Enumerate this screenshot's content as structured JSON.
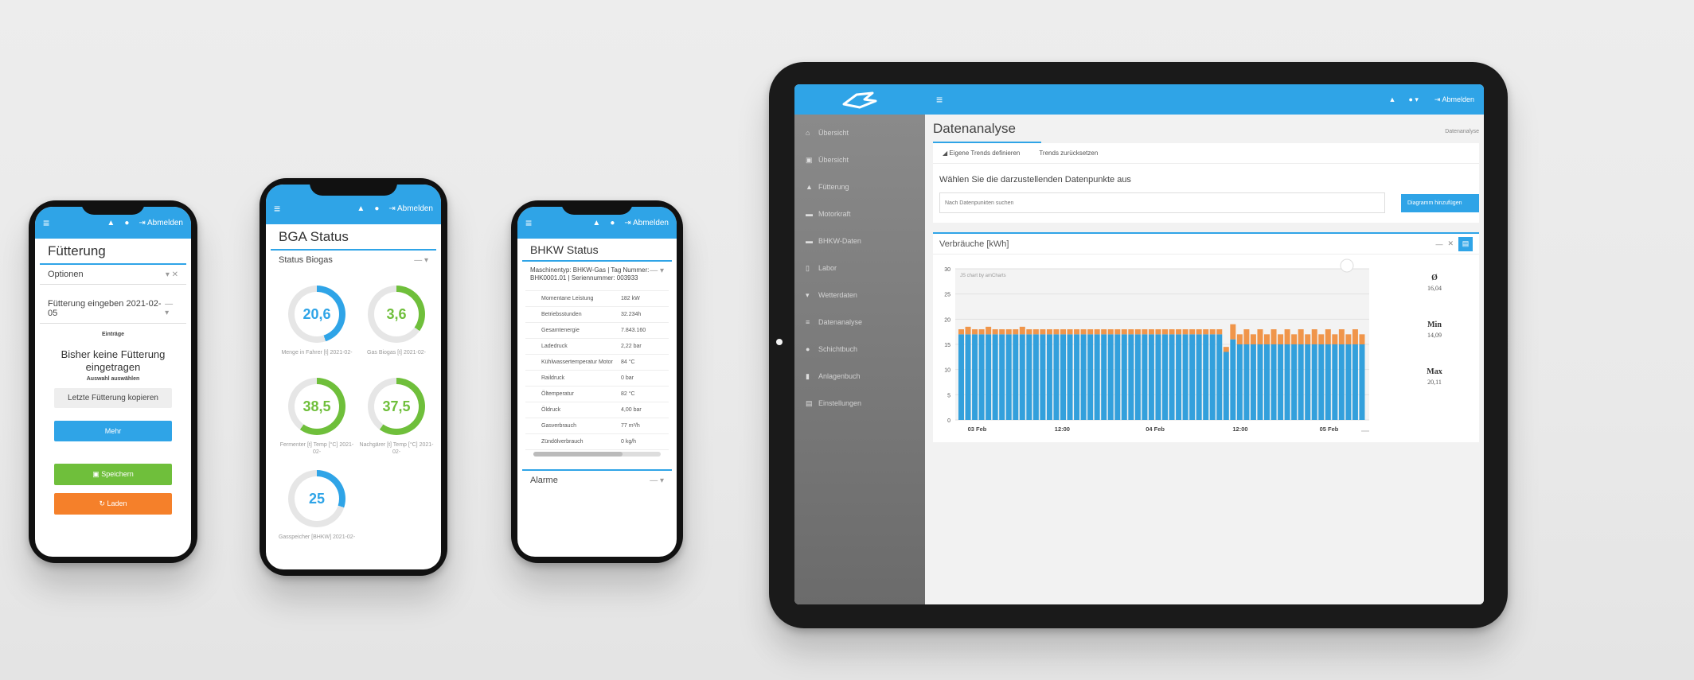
{
  "topbar": {
    "logout": "Abmelden"
  },
  "phone1": {
    "title": "Fütterung",
    "options_label": "Optionen",
    "entry_label": "Fütterung eingeben 2021-02-05",
    "entries_heading": "Einträge",
    "empty_message": "Bisher keine Fütterung eingetragen",
    "select_all": "Auswahl auswählen",
    "copy_last_button": "Letzte Fütterung kopieren",
    "more_button": "Mehr",
    "save_button": "Speichern",
    "reload_button": "Laden"
  },
  "phone2": {
    "title": "BGA Status",
    "panel_title": "Status Biogas",
    "gauges": [
      {
        "value": "20,6",
        "label": "Menge in Fahrer [t] 2021-02-",
        "color": "#2fa4e7",
        "fill": 0.45
      },
      {
        "value": "3,6",
        "label": "Gas Biogas [t] 2021-02-",
        "color": "#6fbf3b",
        "fill": 0.35
      },
      {
        "value": "38,5",
        "label": "Fermenter [t] Temp [°C] 2021-02-",
        "color": "#6fbf3b",
        "fill": 0.6
      },
      {
        "value": "37,5",
        "label": "Nachgärer [t] Temp [°C] 2021-02-",
        "color": "#6fbf3b",
        "fill": 0.6
      },
      {
        "value": "25",
        "label": "Gasspeicher [BHKW] 2021-02-",
        "color": "#2fa4e7",
        "fill": 0.3
      }
    ]
  },
  "phone3": {
    "title": "BHKW Status",
    "header": "Maschinentyp: BHKW-Gas | Tag Nummer: BHK0001.01 | Seriennummer: 003933",
    "rows": [
      {
        "key": "Momentane Leistung",
        "value": "182 kW"
      },
      {
        "key": "Betriebsstunden",
        "value": "32.234h"
      },
      {
        "key": "Gesamtenergie",
        "value": "7.843.160"
      },
      {
        "key": "Ladedruck",
        "value": "2,22 bar"
      },
      {
        "key": "Kühlwassertemperatur Motor",
        "value": "84 °C"
      },
      {
        "key": "Raildruck",
        "value": "0 bar"
      },
      {
        "key": "Öltemperatur",
        "value": "82 °C"
      },
      {
        "key": "Öldruck",
        "value": "4,00 bar"
      },
      {
        "key": "Gasverbrauch",
        "value": "77 m³/h"
      },
      {
        "key": "Zündölverbrauch",
        "value": "0 kg/h"
      }
    ],
    "alarms": "Alarme"
  },
  "tablet": {
    "page_title": "Datenanalyse",
    "breadcrumb": "Datenanalyse",
    "sidebar": [
      {
        "icon": "home-icon",
        "glyph": "⌂",
        "label": "Übersicht"
      },
      {
        "icon": "chart-icon",
        "glyph": "▣",
        "label": "Übersicht"
      },
      {
        "icon": "feed-icon",
        "glyph": "▲",
        "label": "Fütterung"
      },
      {
        "icon": "truck-icon",
        "glyph": "▬",
        "label": "Motorkraft"
      },
      {
        "icon": "engine-icon",
        "glyph": "▬",
        "label": "BHKW-Daten"
      },
      {
        "icon": "file-icon",
        "glyph": "▯",
        "label": "Labor"
      },
      {
        "icon": "arrow-icon",
        "glyph": "▾",
        "label": "Wetterdaten"
      },
      {
        "icon": "analysis-icon",
        "glyph": "≡",
        "label": "Datenanalyse"
      },
      {
        "icon": "pin-icon",
        "glyph": "●",
        "label": "Schichtbuch"
      },
      {
        "icon": "book-icon",
        "glyph": "▮",
        "label": "Anlagenbuch"
      },
      {
        "icon": "settings-icon",
        "glyph": "▤",
        "label": "Einstellungen"
      }
    ],
    "tabs": [
      "Eigene Trends definieren",
      "Trends zurücksetzen"
    ],
    "prompt": "Wählen Sie die darzustellenden Datenpunkte aus",
    "search_placeholder": "Nach Datenpunkten suchen",
    "add_button": "Diagramm hinzufügen",
    "chart_title": "Verbräuche [kWh]",
    "credit": "JS chart by amCharts",
    "stats": [
      {
        "label": "Ø",
        "value": "16,04"
      },
      {
        "label": "Min",
        "value": "14,09"
      },
      {
        "label": "Max",
        "value": "20,11"
      }
    ]
  },
  "chart_data": {
    "type": "bar",
    "title": "Verbräuche [kWh]",
    "x_ticks": [
      "03 Feb",
      "12:00",
      "04 Feb",
      "12:00",
      "05 Feb"
    ],
    "y_ticks": [
      0,
      5,
      10,
      15,
      20,
      25,
      30
    ],
    "ylim": [
      0,
      30
    ],
    "series": [
      {
        "color": "#33a0dc",
        "values": [
          17,
          17,
          17,
          17,
          17,
          17,
          17,
          17,
          17,
          17,
          17,
          17,
          17,
          17,
          17,
          17,
          17,
          17,
          17,
          17,
          17,
          17,
          17,
          17,
          17,
          17,
          17,
          17,
          17,
          17,
          17,
          17,
          17,
          17,
          17,
          17,
          17,
          17,
          17,
          13.5,
          16,
          15,
          15,
          15,
          15,
          15,
          15,
          15,
          15,
          15,
          15,
          15,
          15,
          15,
          15,
          15,
          15,
          15,
          15,
          15
        ]
      },
      {
        "color": "#f0954a",
        "values": [
          1,
          1.5,
          1,
          1,
          1.5,
          1,
          1,
          1,
          1,
          1.5,
          1,
          1,
          1,
          1,
          1,
          1,
          1,
          1,
          1,
          1,
          1,
          1,
          1,
          1,
          1,
          1,
          1,
          1,
          1,
          1,
          1,
          1,
          1,
          1,
          1,
          1,
          1,
          1,
          1,
          1,
          3,
          2,
          3,
          2,
          3,
          2,
          3,
          2,
          3,
          2,
          3,
          2,
          3,
          2,
          3,
          2,
          3,
          2,
          3,
          2
        ]
      }
    ]
  }
}
